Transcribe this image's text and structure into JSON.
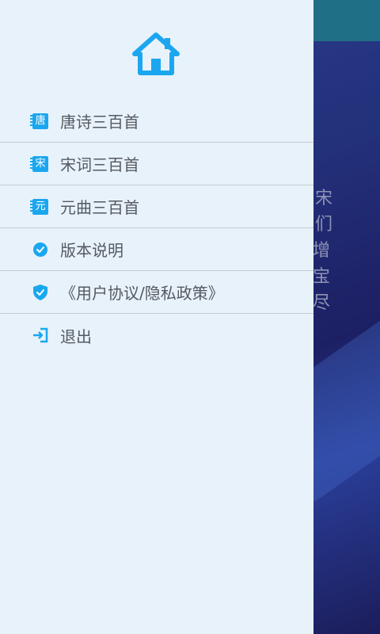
{
  "background": {
    "text_lines": [
      "宋",
      "们",
      "译增",
      "深宝",
      "会尽"
    ]
  },
  "drawer": {
    "home_icon": "home-icon",
    "accent_color": "#1ba7ef",
    "items": [
      {
        "label": "唐诗三百首",
        "icon": "book-icon",
        "icon_char": "唐"
      },
      {
        "label": "宋词三百首",
        "icon": "book-icon",
        "icon_char": "宋"
      },
      {
        "label": "元曲三百首",
        "icon": "book-icon",
        "icon_char": "元"
      },
      {
        "label": "版本说明",
        "icon": "check-circle-icon"
      },
      {
        "label": "《用户协议/隐私政策》",
        "icon": "shield-check-icon"
      },
      {
        "label": "退出",
        "icon": "exit-icon"
      }
    ]
  }
}
